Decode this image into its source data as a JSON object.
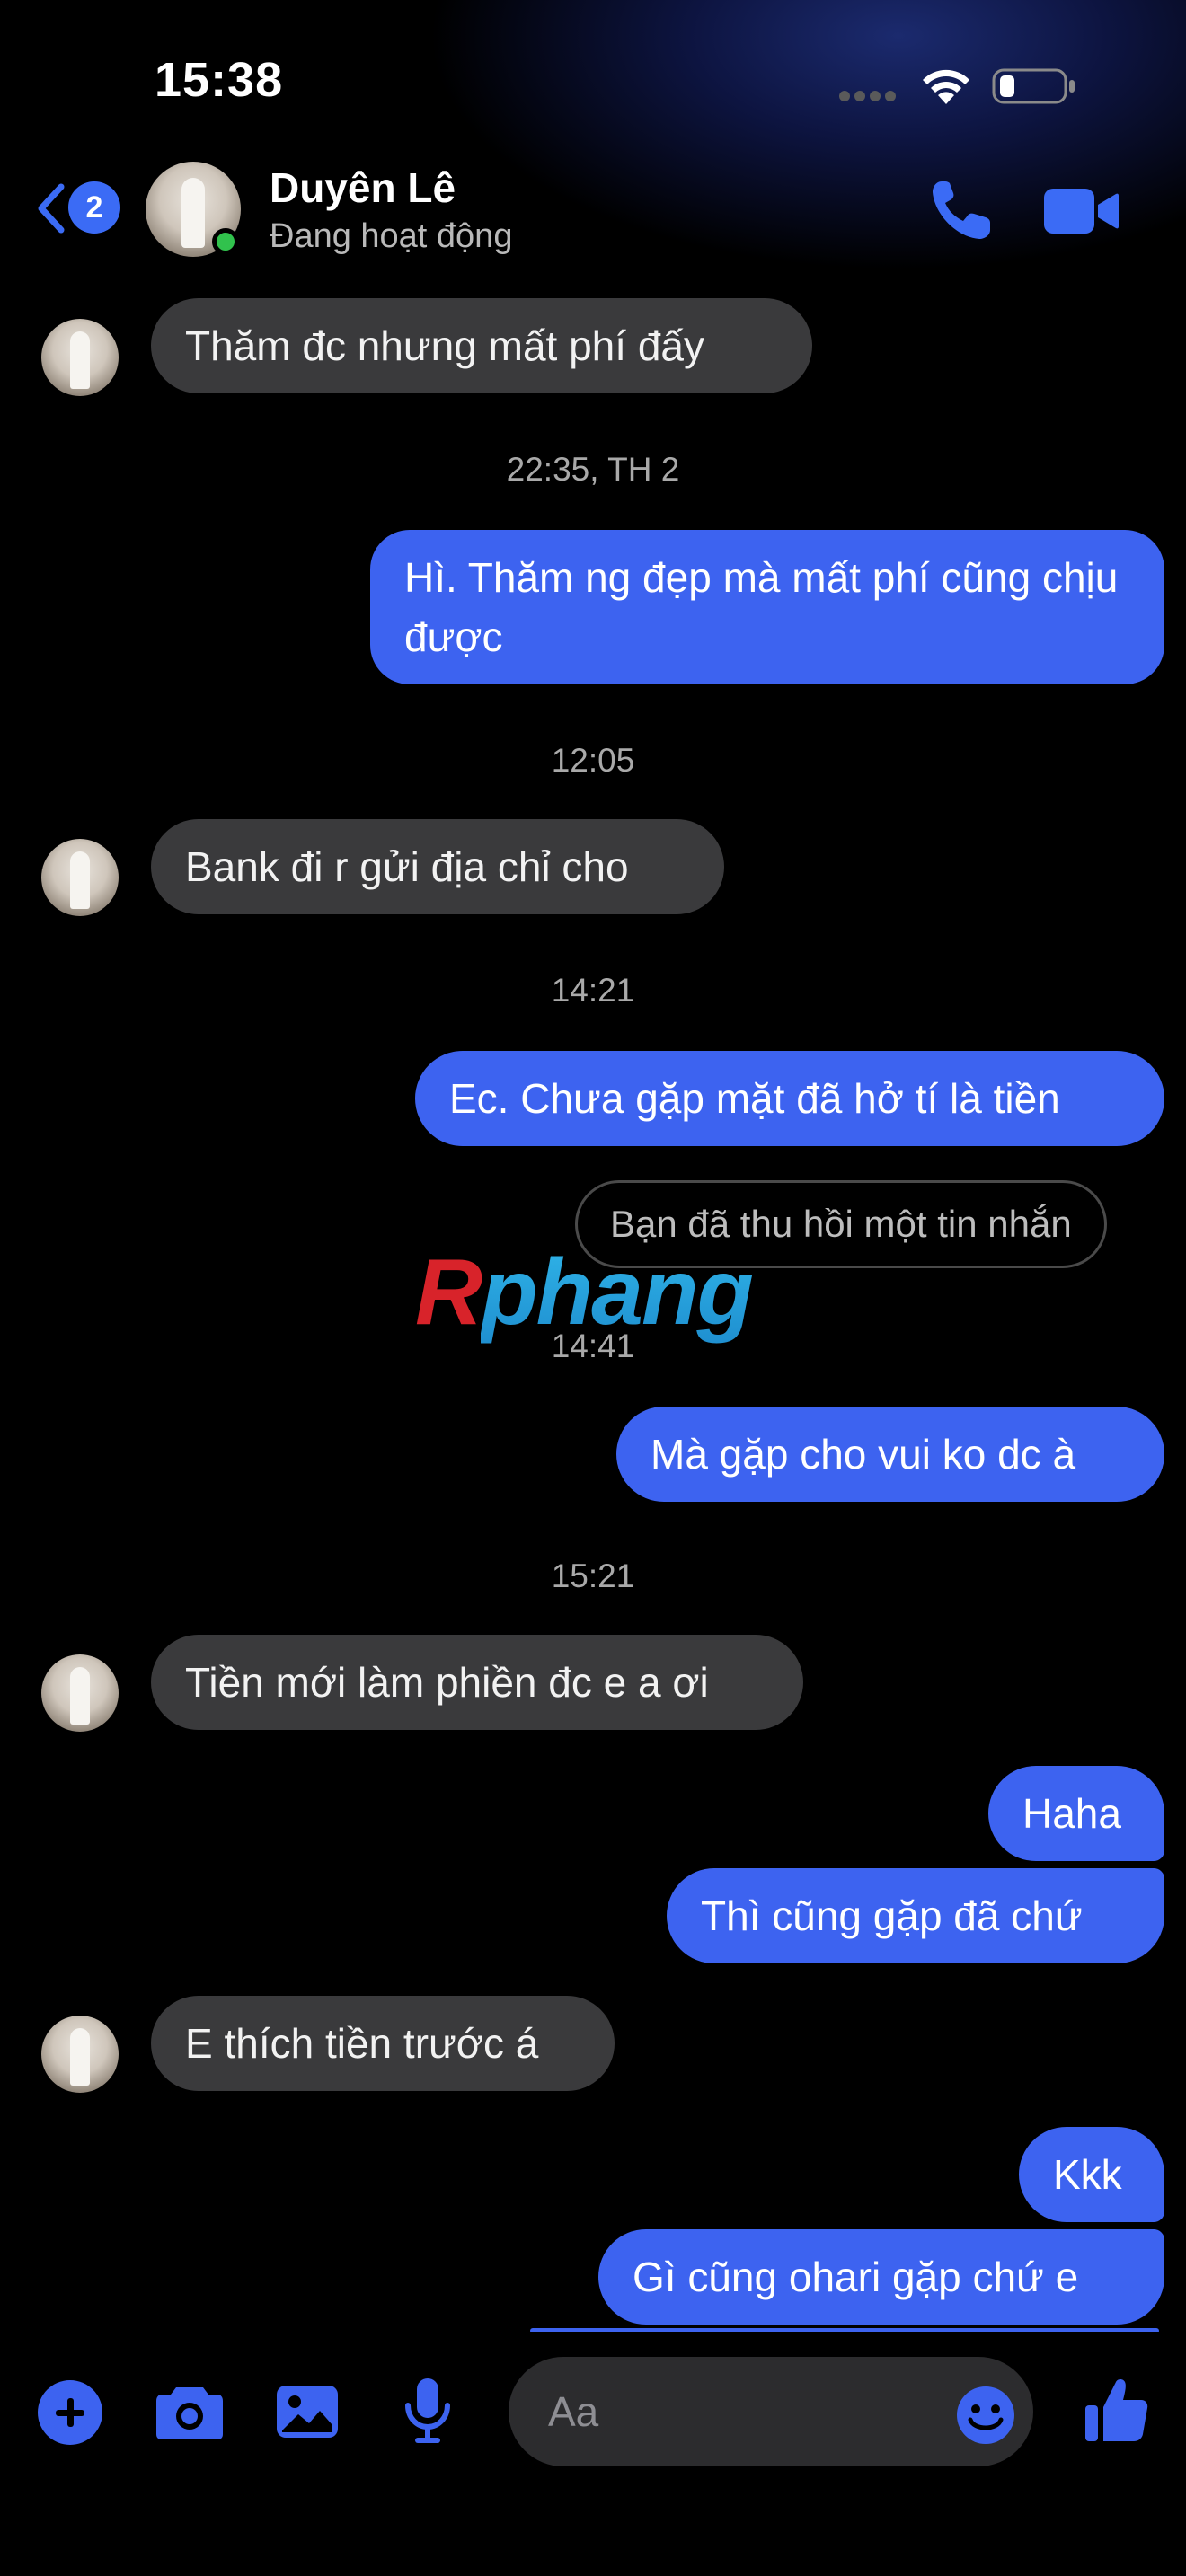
{
  "status_bar": {
    "time": "15:38"
  },
  "header": {
    "back_badge_count": "2",
    "contact_name": "Duyên Lê",
    "contact_status": "Đang hoạt động"
  },
  "watermark": {
    "r": "R",
    "rest": "phang"
  },
  "messages": {
    "m1": "Thăm đc nhưng mất phí đấy",
    "t1": "22:35, TH 2",
    "m2": "Hì. Thăm ng đẹp mà mất phí cũng chịu được",
    "t2": "12:05",
    "m3": "Bank đi r gửi địa chỉ cho",
    "t3": "14:21",
    "m4": "Ec. Chưa gặp mặt đã hở tí là tiền",
    "recalled": "Bạn đã thu hồi một tin nhắn",
    "t4": "14:41",
    "m5": "Mà gặp cho vui ko dc à",
    "t5": "15:21",
    "m6": "Tiền mới làm phiền đc e a ơi",
    "m7": "Haha",
    "m8": "Thì cũng gặp đã chứ",
    "m9": "E thích tiền trước á",
    "m10": "Kkk",
    "m11": "Gì cũng ohari gặp chứ e"
  },
  "composer": {
    "placeholder": "Aa"
  },
  "colors": {
    "outgoing_bubble": "#3d63f0",
    "incoming_bubble": "#3a3a3c",
    "accent": "#3b6bf5",
    "online": "#31c24d"
  },
  "icons": {
    "back": "chevron-left-icon",
    "call": "phone-icon",
    "video": "video-camera-icon",
    "plus": "plus-icon",
    "camera": "camera-icon",
    "gallery": "image-icon",
    "mic": "microphone-icon",
    "emoji": "smiley-icon",
    "like": "thumbs-up-icon"
  }
}
